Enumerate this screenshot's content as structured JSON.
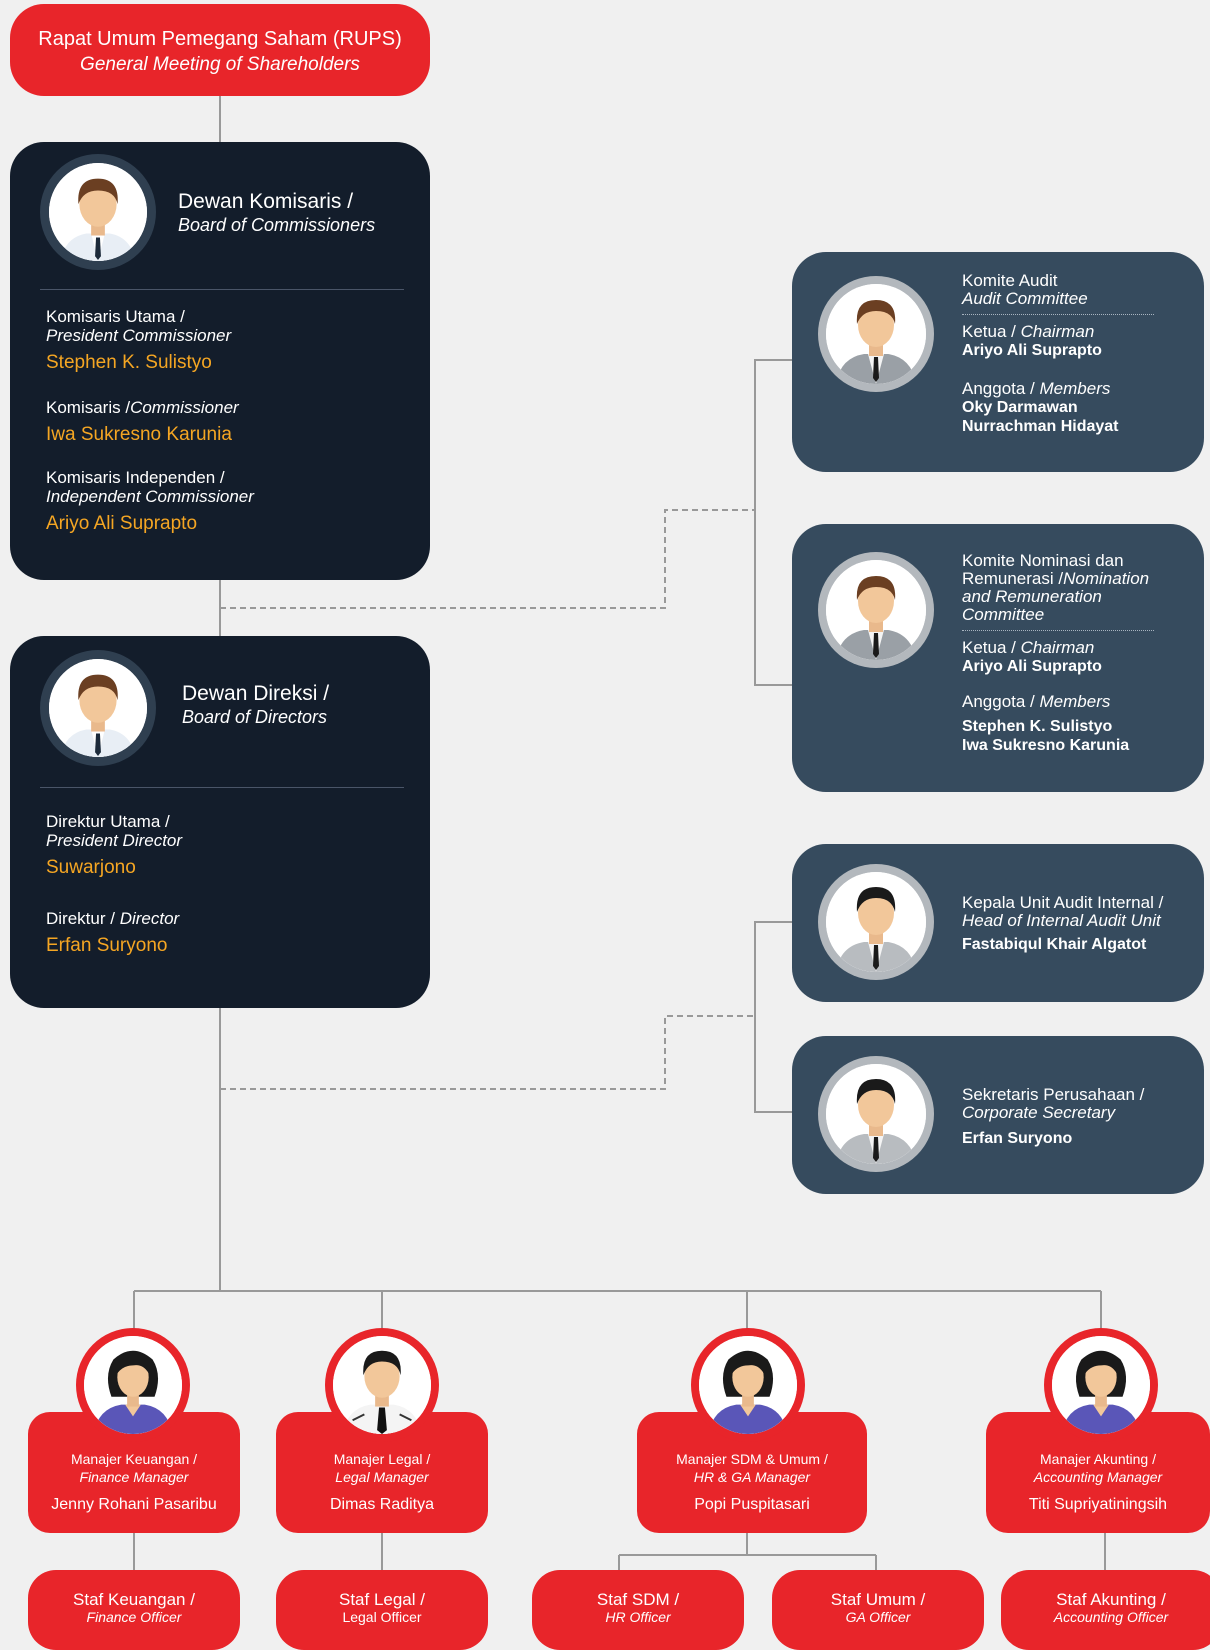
{
  "rups": {
    "title": "Rapat Umum Pemegang Saham (RUPS)",
    "title_en": "General Meeting of Shareholders"
  },
  "commissioners": {
    "title": "Dewan Komisaris /",
    "title_en": "Board of Commissioners",
    "icon": "male-avatar-icon",
    "members": [
      {
        "role": "Komisaris Utama /",
        "role_en": "President Commissioner",
        "name": "Stephen K. Sulistyo"
      },
      {
        "role": "Komisaris /",
        "role_en": "Commissioner",
        "name": "Iwa Sukresno Karunia"
      },
      {
        "role": "Komisaris Independen /",
        "role_en": "Independent Commissioner",
        "name": "Ariyo Ali Suprapto"
      }
    ]
  },
  "directors": {
    "title": "Dewan Direksi /",
    "title_en": "Board of Directors",
    "icon": "male-avatar-icon",
    "members": [
      {
        "role": "Direktur  Utama /",
        "role_en": "President Director",
        "name": "Suwarjono"
      },
      {
        "role": "Direktur /",
        "role_en": "Director",
        "name": "Erfan Suryono"
      }
    ]
  },
  "audit_committee": {
    "title": "Komite Audit",
    "title_en": "Audit Committee",
    "chair_label": "Ketua /",
    "chair_label_en": "Chairman",
    "chair": "Ariyo Ali Suprapto",
    "members_label": "Anggota /",
    "members_label_en": "Members",
    "members": [
      "Oky Darmawan",
      "Nurrachman Hidayat"
    ]
  },
  "nomination_committee": {
    "title_1": "Komite  Nominasi dan",
    "title_2": "Remunerasi /",
    "title_en_1": "Nomination",
    "title_en_2": "and Remuneration",
    "title_en_3": "Committee",
    "chair_label": "Ketua /",
    "chair_label_en": "Chairman",
    "chair": "Ariyo Ali Suprapto",
    "members_label": "Anggota /",
    "members_label_en": "Members",
    "members": [
      "Stephen K. Sulistyo",
      "Iwa Sukresno Karunia"
    ]
  },
  "internal_audit": {
    "title": "Kepala Unit Audit Internal /",
    "title_en": "Head of Internal Audit Unit",
    "name": "Fastabiqul Khair Algatot"
  },
  "corporate_secretary": {
    "title": "Sekretaris Perusahaan /",
    "title_en": "Corporate Secretary",
    "name": "Erfan Suryono"
  },
  "managers": [
    {
      "role": "Manajer Keuangan /",
      "role_en": "Finance Manager",
      "name": "Jenny Rohani Pasaribu",
      "icon": "female-avatar-icon"
    },
    {
      "role": "Manajer Legal /",
      "role_en": "Legal Manager",
      "name": "Dimas Raditya",
      "icon": "male-avatar-icon"
    },
    {
      "role": "Manajer SDM & Umum /",
      "role_en": "HR & GA Manager",
      "name": "Popi Puspitasari",
      "icon": "female-avatar-icon"
    },
    {
      "role": "Manajer Akunting /",
      "role_en": "Accounting Manager",
      "name": "Titi Supriyatiningsih",
      "icon": "female-avatar-icon"
    }
  ],
  "staff": [
    {
      "role": "Staf Keuangan /",
      "role_en": "Finance Officer"
    },
    {
      "role": "Staf Legal /",
      "role_en": "Legal Officer"
    },
    {
      "role": "Staf SDM /",
      "role_en": "HR Officer"
    },
    {
      "role": "Staf Umum /",
      "role_en": "GA Officer"
    },
    {
      "role": "Staf Akunting /",
      "role_en": "Accounting Officer"
    }
  ],
  "colors": {
    "red": "#e8252a",
    "dark": "#131d2b",
    "slate": "#364b5e",
    "orange": "#f5a623",
    "background": "#f0f0f0"
  }
}
